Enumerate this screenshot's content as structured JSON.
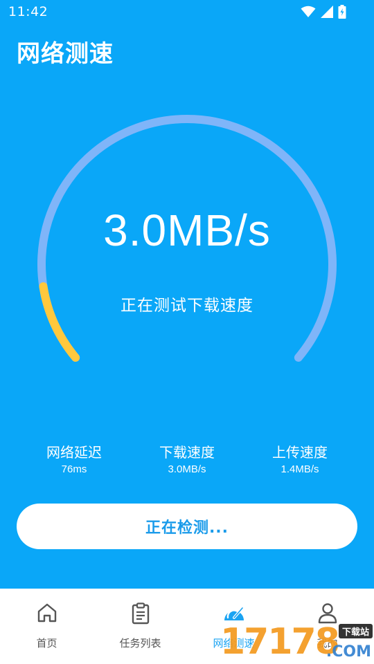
{
  "status_bar": {
    "time": "11:42",
    "icons": [
      "wifi-icon",
      "signal-icon",
      "battery-charging-icon"
    ]
  },
  "header": {
    "title": "网络测速"
  },
  "gauge": {
    "speed_value": "3.0MB/s",
    "status_text": "正在测试下载速度",
    "progress_fraction": 0.12,
    "track_color": "#7fb5f9",
    "progress_color": "#ffc83d"
  },
  "stats": [
    {
      "label": "网络延迟",
      "value": "76ms"
    },
    {
      "label": "下载速度",
      "value": "3.0MB/s"
    },
    {
      "label": "上传速度",
      "value": "1.4MB/s"
    }
  ],
  "action_button": {
    "label": "正在检测..."
  },
  "bottom_nav": {
    "items": [
      {
        "label": "首页",
        "icon": "home-icon",
        "active": false
      },
      {
        "label": "任务列表",
        "icon": "clipboard-icon",
        "active": false
      },
      {
        "label": "网络测速",
        "icon": "speedometer-icon",
        "active": true
      },
      {
        "label": "我的",
        "icon": "user-icon",
        "active": false
      }
    ]
  },
  "watermark": {
    "digits": "17178",
    "site": "下载站",
    "domain": ".COM"
  },
  "colors": {
    "background": "#0aa7f8",
    "accent": "#1aa3f2",
    "nav_inactive": "#555555"
  }
}
